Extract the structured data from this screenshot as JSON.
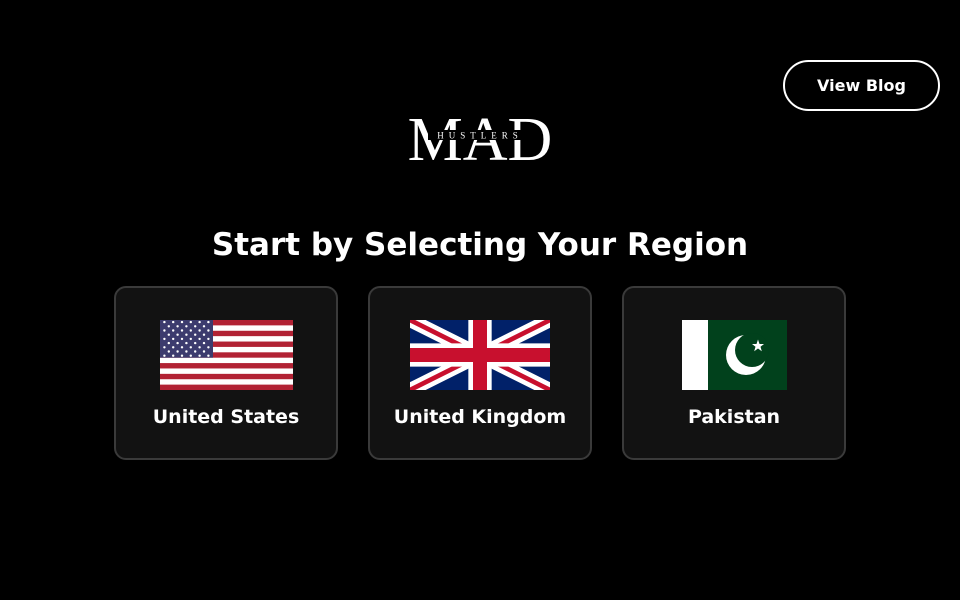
{
  "header": {
    "view_blog_label": "View Blog"
  },
  "logo": {
    "wordmark": "MAD",
    "tagline": "HUSTLERS"
  },
  "main": {
    "title": "Start by Selecting Your Region",
    "regions": [
      {
        "label": "United States",
        "flag_icon": "us-flag-icon"
      },
      {
        "label": "United Kingdom",
        "flag_icon": "uk-flag-icon"
      },
      {
        "label": "Pakistan",
        "flag_icon": "pakistan-flag-icon"
      }
    ]
  },
  "colors": {
    "background": "#000000",
    "card_background": "#121212",
    "card_border": "#3a3a3a",
    "us_red": "#B22234",
    "us_blue": "#3C3B6E",
    "uk_blue": "#012169",
    "uk_red": "#C8102E",
    "pk_green": "#01411C"
  }
}
